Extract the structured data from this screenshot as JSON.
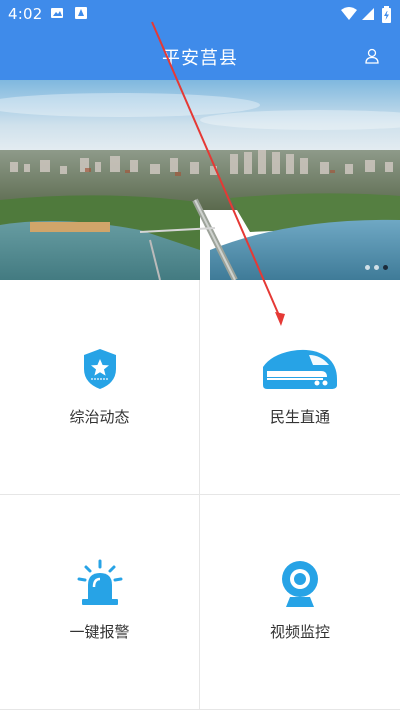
{
  "status_bar": {
    "time": "4:02",
    "icons": [
      "gallery-icon",
      "notification-icon",
      "wifi-icon",
      "signal-icon",
      "battery-icon"
    ]
  },
  "app_bar": {
    "title": "平安莒县",
    "right_icon": "user-icon"
  },
  "banner": {
    "carousel_count": 3,
    "active_index": 2
  },
  "grid": {
    "items": [
      {
        "label": "综治动态",
        "icon": "shield-star-icon"
      },
      {
        "label": "民生直通",
        "icon": "train-icon"
      },
      {
        "label": "一键报警",
        "icon": "alarm-icon"
      },
      {
        "label": "视频监控",
        "icon": "webcam-icon"
      }
    ]
  },
  "colors": {
    "primary": "#3f8bea",
    "icon_blue": "#27a3e6",
    "annotation_red": "#e53935"
  }
}
